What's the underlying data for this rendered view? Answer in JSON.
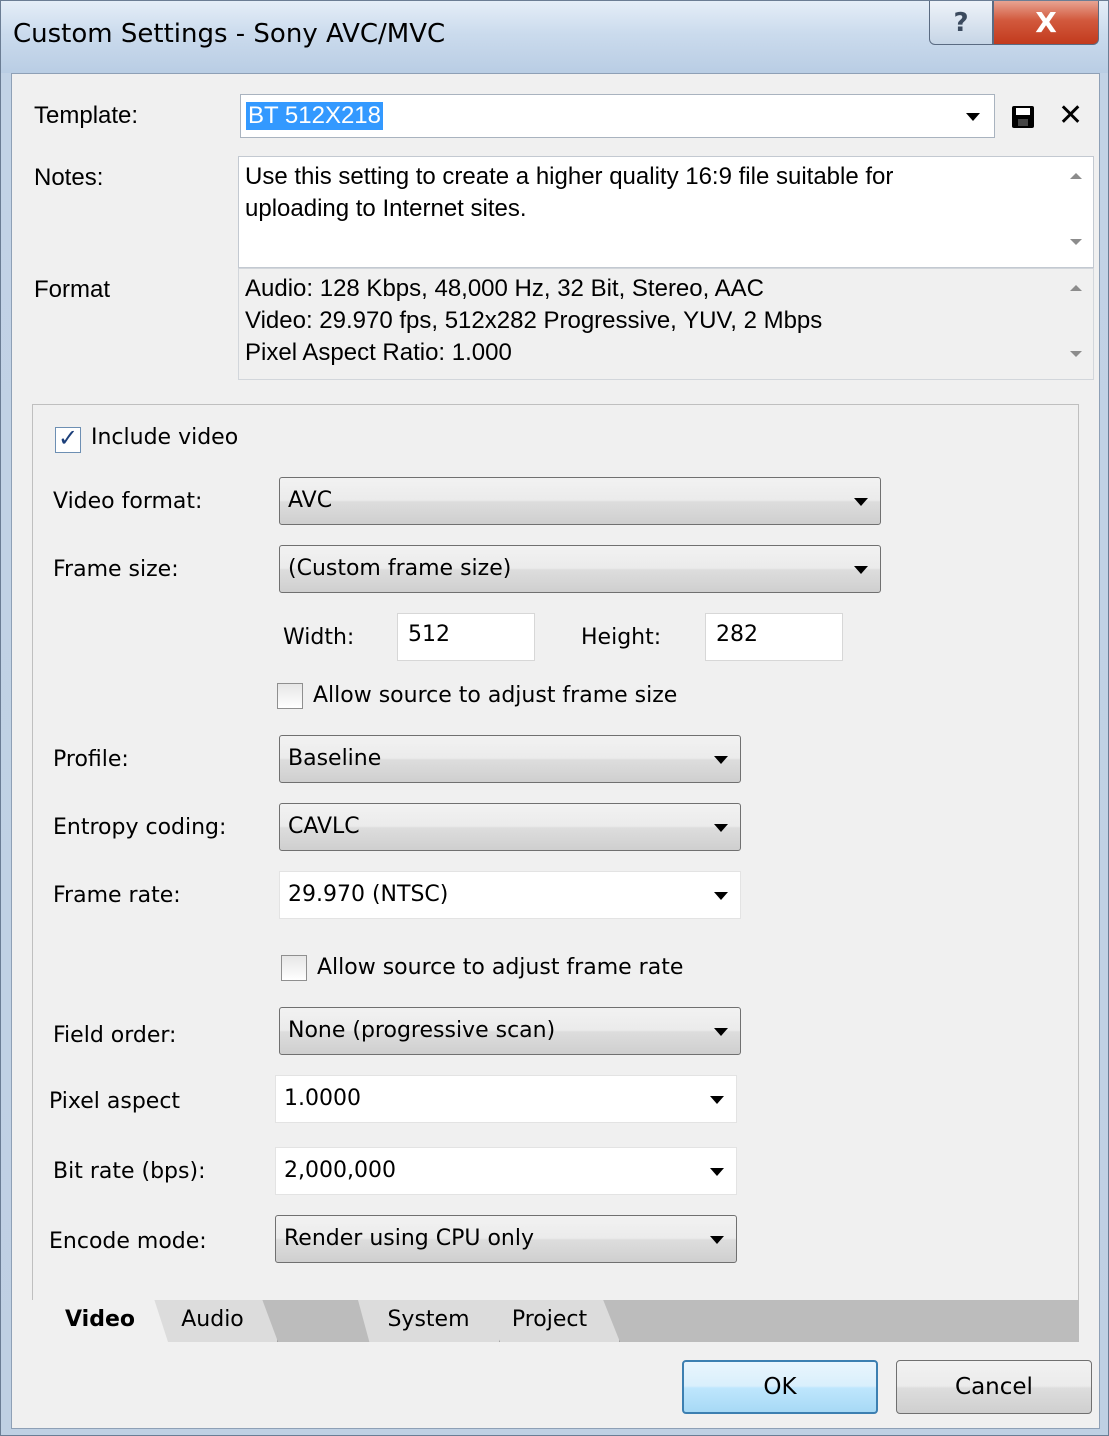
{
  "window": {
    "title": "Custom Settings - Sony AVC/MVC",
    "help_label": "?",
    "close_label": "X"
  },
  "template": {
    "label": "Template:",
    "value": "BT 512X218"
  },
  "notes": {
    "label": "Notes:",
    "lines": [
      "Use this setting to create a higher quality 16:9 file suitable for",
      "uploading to Internet sites."
    ]
  },
  "format": {
    "label": "Format",
    "lines": [
      "Audio: 128 Kbps, 48,000 Hz, 32 Bit, Stereo, AAC",
      "Video: 29.970 fps, 512x282 Progressive, YUV, 2 Mbps",
      "Pixel Aspect Ratio: 1.000"
    ]
  },
  "video": {
    "include_video_label": "Include video",
    "include_video_checked": true,
    "video_format_label": "Video format:",
    "video_format_value": "AVC",
    "frame_size_label": "Frame size:",
    "frame_size_value": "(Custom frame size)",
    "width_label": "Width:",
    "width_value": "512",
    "height_label": "Height:",
    "height_value": "282",
    "allow_frame_size_label": "Allow source to adjust frame size",
    "allow_frame_size_checked": false,
    "profile_label": "Profile:",
    "profile_value": "Baseline",
    "entropy_label": "Entropy coding:",
    "entropy_value": "CAVLC",
    "frame_rate_label": "Frame rate:",
    "frame_rate_value": "29.970 (NTSC)",
    "allow_frame_rate_label": "Allow source to adjust frame rate",
    "allow_frame_rate_checked": false,
    "field_order_label": "Field order:",
    "field_order_value": "None (progressive scan)",
    "pixel_aspect_label": "Pixel aspect",
    "pixel_aspect_value": "1.0000",
    "bit_rate_label": "Bit rate (bps):",
    "bit_rate_value": "2,000,000",
    "encode_mode_label": "Encode mode:",
    "encode_mode_value": "Render using CPU only"
  },
  "tabs": [
    {
      "label": "Video",
      "active": true
    },
    {
      "label": "Audio",
      "active": false
    },
    {
      "label": "System",
      "active": false
    },
    {
      "label": "Project",
      "active": false
    }
  ],
  "buttons": {
    "ok": "OK",
    "cancel": "Cancel"
  },
  "icons": {
    "save": "floppy-disk-icon",
    "delete": "close-x-icon",
    "dropdown": "chevron-down-icon",
    "check": "checkmark-icon"
  }
}
